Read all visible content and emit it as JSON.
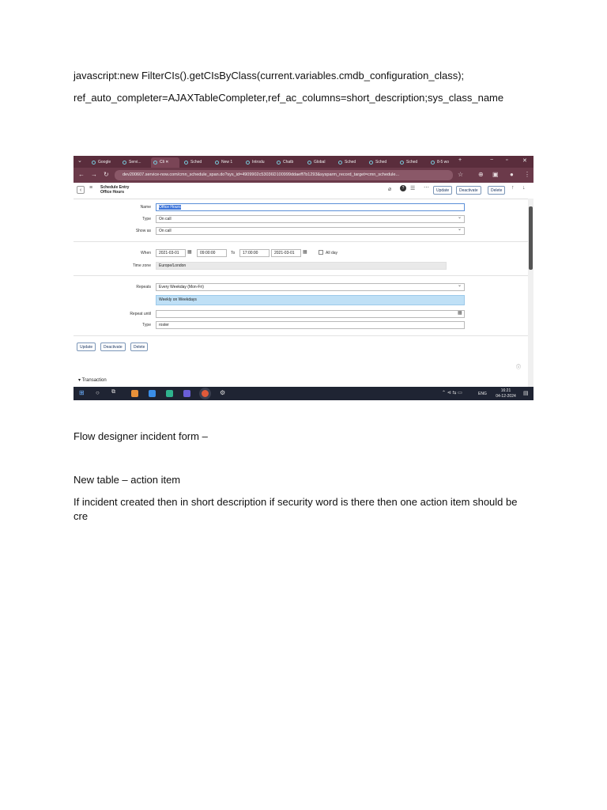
{
  "doc": {
    "line1": "javascript:new FilterCIs().getCIsByClass(current.variables.cmdb_configuration_class);",
    "line2": "ref_auto_completer=AJAXTableCompleter,ref_ac_columns=short_description;sys_class_name",
    "line3": "Flow designer incident form –",
    "line4": "New table – action item",
    "line5": "If incident created then in short description if security word is there then one action item should be cre"
  },
  "screenshot": {
    "tabs": [
      "Google",
      "Servi...",
      "Cli",
      "Sched",
      "New 1",
      "Introdu",
      "Chatb",
      "Global",
      "Sched",
      "Sched",
      "Sched",
      "8-5 wo"
    ],
    "url": "dev200607.service-now.com/cmn_schedule_span.do?sys_id=4909902c53036D100999ddaeff7b1293&sysparm_record_target=cmn_schedule...",
    "header_title": "Schedule Entry",
    "header_subtitle": "Office Hours",
    "buttons": {
      "update": "Update",
      "deactivate": "Deactivate",
      "delete": "Delete"
    },
    "form": {
      "name_label": "Name",
      "name_value": "Office Hours",
      "type_label": "Type",
      "type_value": "On call",
      "show_as_label": "Show as",
      "show_as_value": "On call",
      "when_label": "When",
      "when_date": "2021-03-01",
      "when_time": "09:00:00",
      "to_label": "To",
      "to_time": "17:00:00",
      "to_date": "2021-03-01",
      "all_day_label": "All day",
      "timezone_label": "Time zone",
      "timezone_value": "Europe/London",
      "repeats_label": "Repeats",
      "repeats_value": "Every Weekday (Mon-Fri)",
      "repeats_summary": "Weekly on Weekdays",
      "repeat_until_label": "Repeat until",
      "repeat_until_value": "",
      "type2_label": "Type",
      "type2_value": "roster"
    },
    "transaction_label": "Transaction",
    "taskbar": {
      "lang": "ENG",
      "time": "16:21",
      "date": "04-12-2024"
    }
  }
}
